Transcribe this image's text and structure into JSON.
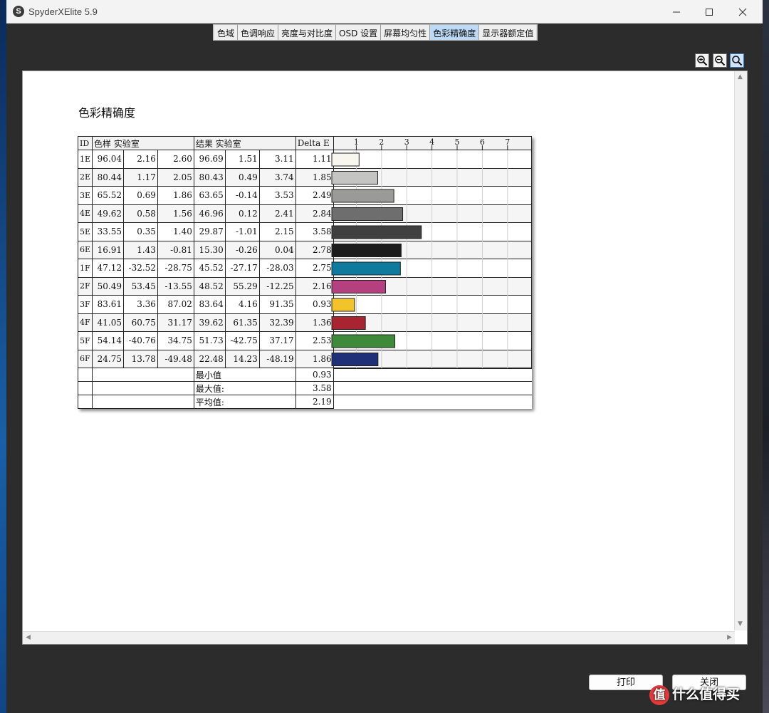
{
  "window": {
    "icon_letter": "S",
    "title": "SpyderXElite 5.9"
  },
  "tabs": [
    {
      "label": "色域",
      "active": false
    },
    {
      "label": "色调响应",
      "active": false
    },
    {
      "label": "亮度与对比度",
      "active": false
    },
    {
      "label": "OSD 设置",
      "active": false
    },
    {
      "label": "屏幕均匀性",
      "active": false
    },
    {
      "label": "色彩精确度",
      "active": true
    },
    {
      "label": "显示器额定值",
      "active": false
    }
  ],
  "zoom_tools": [
    {
      "icon": "zoom-in-icon"
    },
    {
      "icon": "zoom-out-icon"
    },
    {
      "icon": "zoom-fit-icon",
      "active": true
    }
  ],
  "report": {
    "title": "色彩精确度",
    "headers": {
      "id": "ID",
      "sample": "色样  实验室",
      "result": "结果  实验室",
      "delta": "Delta E"
    },
    "summary": [
      {
        "label": "最小值",
        "value": "0.93"
      },
      {
        "label": "最大值:",
        "value": "3.58"
      },
      {
        "label": "平均值:",
        "value": "2.19"
      }
    ]
  },
  "chart_data": {
    "type": "bar",
    "orientation": "horizontal",
    "title": "",
    "xlabel": "Delta E",
    "xlim": [
      0,
      8
    ],
    "x_ticks": [
      "1",
      "2",
      "3",
      "4",
      "5",
      "6",
      "7"
    ],
    "grid": true,
    "categories": [
      "1E",
      "2E",
      "3E",
      "4E",
      "5E",
      "6E",
      "1F",
      "2F",
      "3F",
      "4F",
      "5F",
      "6F"
    ],
    "values": [
      1.11,
      1.85,
      2.49,
      2.84,
      3.58,
      2.78,
      2.75,
      2.16,
      0.93,
      1.36,
      2.53,
      1.86
    ],
    "bar_colors": [
      "#f8f6ee",
      "#c4c4c2",
      "#9a9a98",
      "#6e6e6e",
      "#404040",
      "#1c1c1c",
      "#0e7a9e",
      "#b5407f",
      "#f2c32a",
      "#a82430",
      "#3e8a3a",
      "#1f2f78"
    ],
    "sample_lab": [
      [
        "96.04",
        "2.16",
        "2.60"
      ],
      [
        "80.44",
        "1.17",
        "2.05"
      ],
      [
        "65.52",
        "0.69",
        "1.86"
      ],
      [
        "49.62",
        "0.58",
        "1.56"
      ],
      [
        "33.55",
        "0.35",
        "1.40"
      ],
      [
        "16.91",
        "1.43",
        "-0.81"
      ],
      [
        "47.12",
        "-32.52",
        "-28.75"
      ],
      [
        "50.49",
        "53.45",
        "-13.55"
      ],
      [
        "83.61",
        "3.36",
        "87.02"
      ],
      [
        "41.05",
        "60.75",
        "31.17"
      ],
      [
        "54.14",
        "-40.76",
        "34.75"
      ],
      [
        "24.75",
        "13.78",
        "-49.48"
      ]
    ],
    "result_lab": [
      [
        "96.69",
        "1.51",
        "3.11"
      ],
      [
        "80.43",
        "0.49",
        "3.74"
      ],
      [
        "63.65",
        "-0.14",
        "3.53"
      ],
      [
        "46.96",
        "0.12",
        "2.41"
      ],
      [
        "29.87",
        "-1.01",
        "2.15"
      ],
      [
        "15.30",
        "-0.26",
        "0.04"
      ],
      [
        "45.52",
        "-27.17",
        "-28.03"
      ],
      [
        "48.52",
        "55.29",
        "-12.25"
      ],
      [
        "83.64",
        "4.16",
        "91.35"
      ],
      [
        "39.62",
        "61.35",
        "32.39"
      ],
      [
        "51.73",
        "-42.75",
        "37.17"
      ],
      [
        "22.48",
        "14.23",
        "-48.19"
      ]
    ],
    "delta_e_labels": [
      "1.11",
      "1.85",
      "2.49",
      "2.84",
      "3.58",
      "2.78",
      "2.75",
      "2.16",
      "0.93",
      "1.36",
      "2.53",
      "1.86"
    ]
  },
  "buttons": {
    "print": "打印",
    "close": "关闭"
  },
  "watermark": {
    "badge": "值",
    "text": "什么值得买"
  }
}
